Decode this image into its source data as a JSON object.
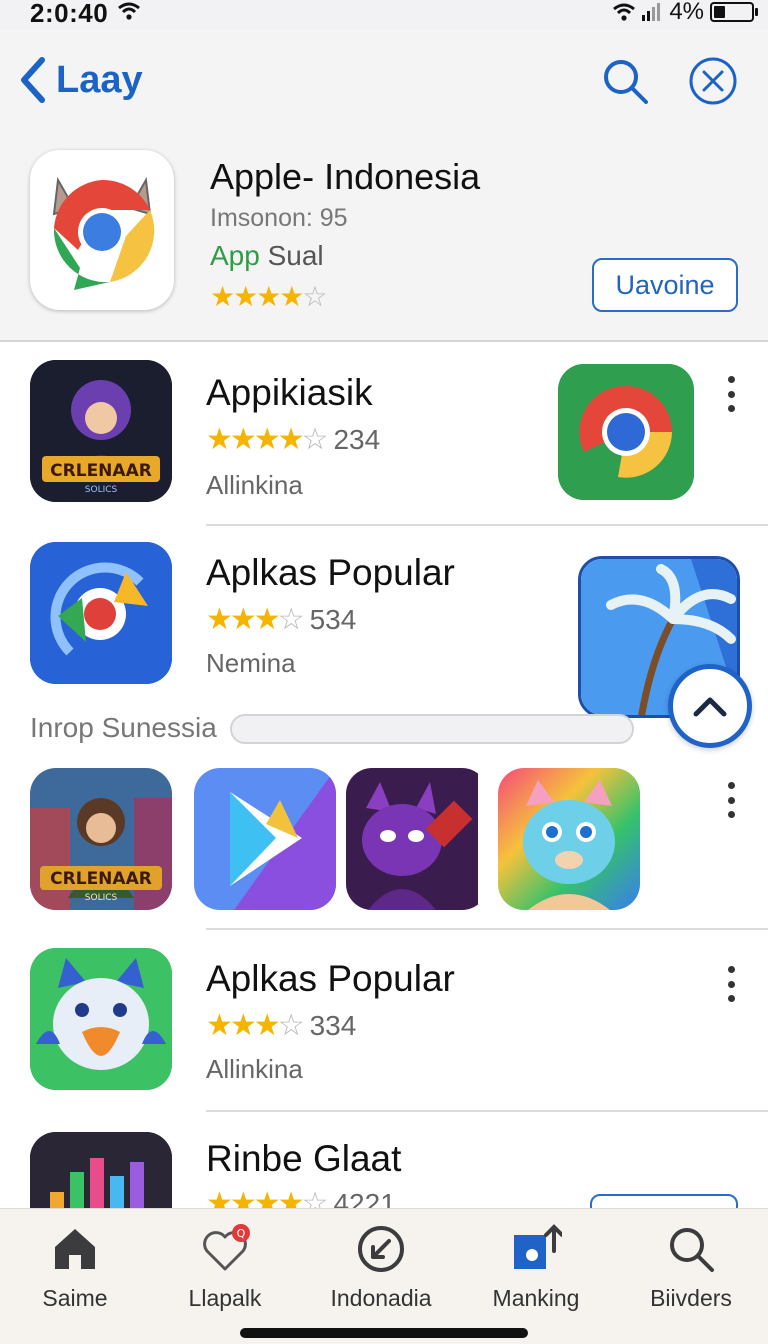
{
  "status_bar": {
    "time": "2:0:40",
    "battery_pct": "4%",
    "battery_level": 0.3
  },
  "header": {
    "back_label": "Laay",
    "featured": {
      "title": "Apple- Indonesia",
      "subtitle": "Imsonon: 95",
      "tag_green": "App",
      "tag_rest": " Sual",
      "rating": 4,
      "button_label": "Uavoine"
    }
  },
  "rows": [
    {
      "title": "Appikiasik",
      "rating": 4,
      "rating_text": "★★★★☆",
      "count": "234",
      "subtitle": "Allinkina"
    },
    {
      "title": "Aplkas Popular",
      "rating": 3,
      "rating_text": "★★★☆",
      "count": "534",
      "subtitle": "Nemina"
    },
    {
      "title": "Aplkas Popular",
      "rating": 3,
      "rating_text": "★★★☆",
      "count": "334",
      "subtitle": "Allinkina"
    },
    {
      "title": "Rinbe Glaat",
      "rating": 4,
      "rating_text": "★★★★☆",
      "count": "4221"
    }
  ],
  "section": {
    "label": "Inrop Sunessia"
  },
  "featured_icon_texts": {
    "game1": "CRLENAAR",
    "game1_sub": "SOLICS",
    "game2": "CRLENAAR",
    "game2_sub": "SOLICS"
  },
  "tabs": [
    {
      "label": "Saime",
      "icon": "home-icon"
    },
    {
      "label": "Llapalk",
      "icon": "heart-icon",
      "badge": "Q"
    },
    {
      "label": "Indonadia",
      "icon": "compass-icon"
    },
    {
      "label": "Manking",
      "icon": "share-icon"
    },
    {
      "label": "Biivders",
      "icon": "search-icon"
    }
  ],
  "colors": {
    "accent": "#1b63c4",
    "star": "#f4b400",
    "green": "#2e9d46"
  }
}
